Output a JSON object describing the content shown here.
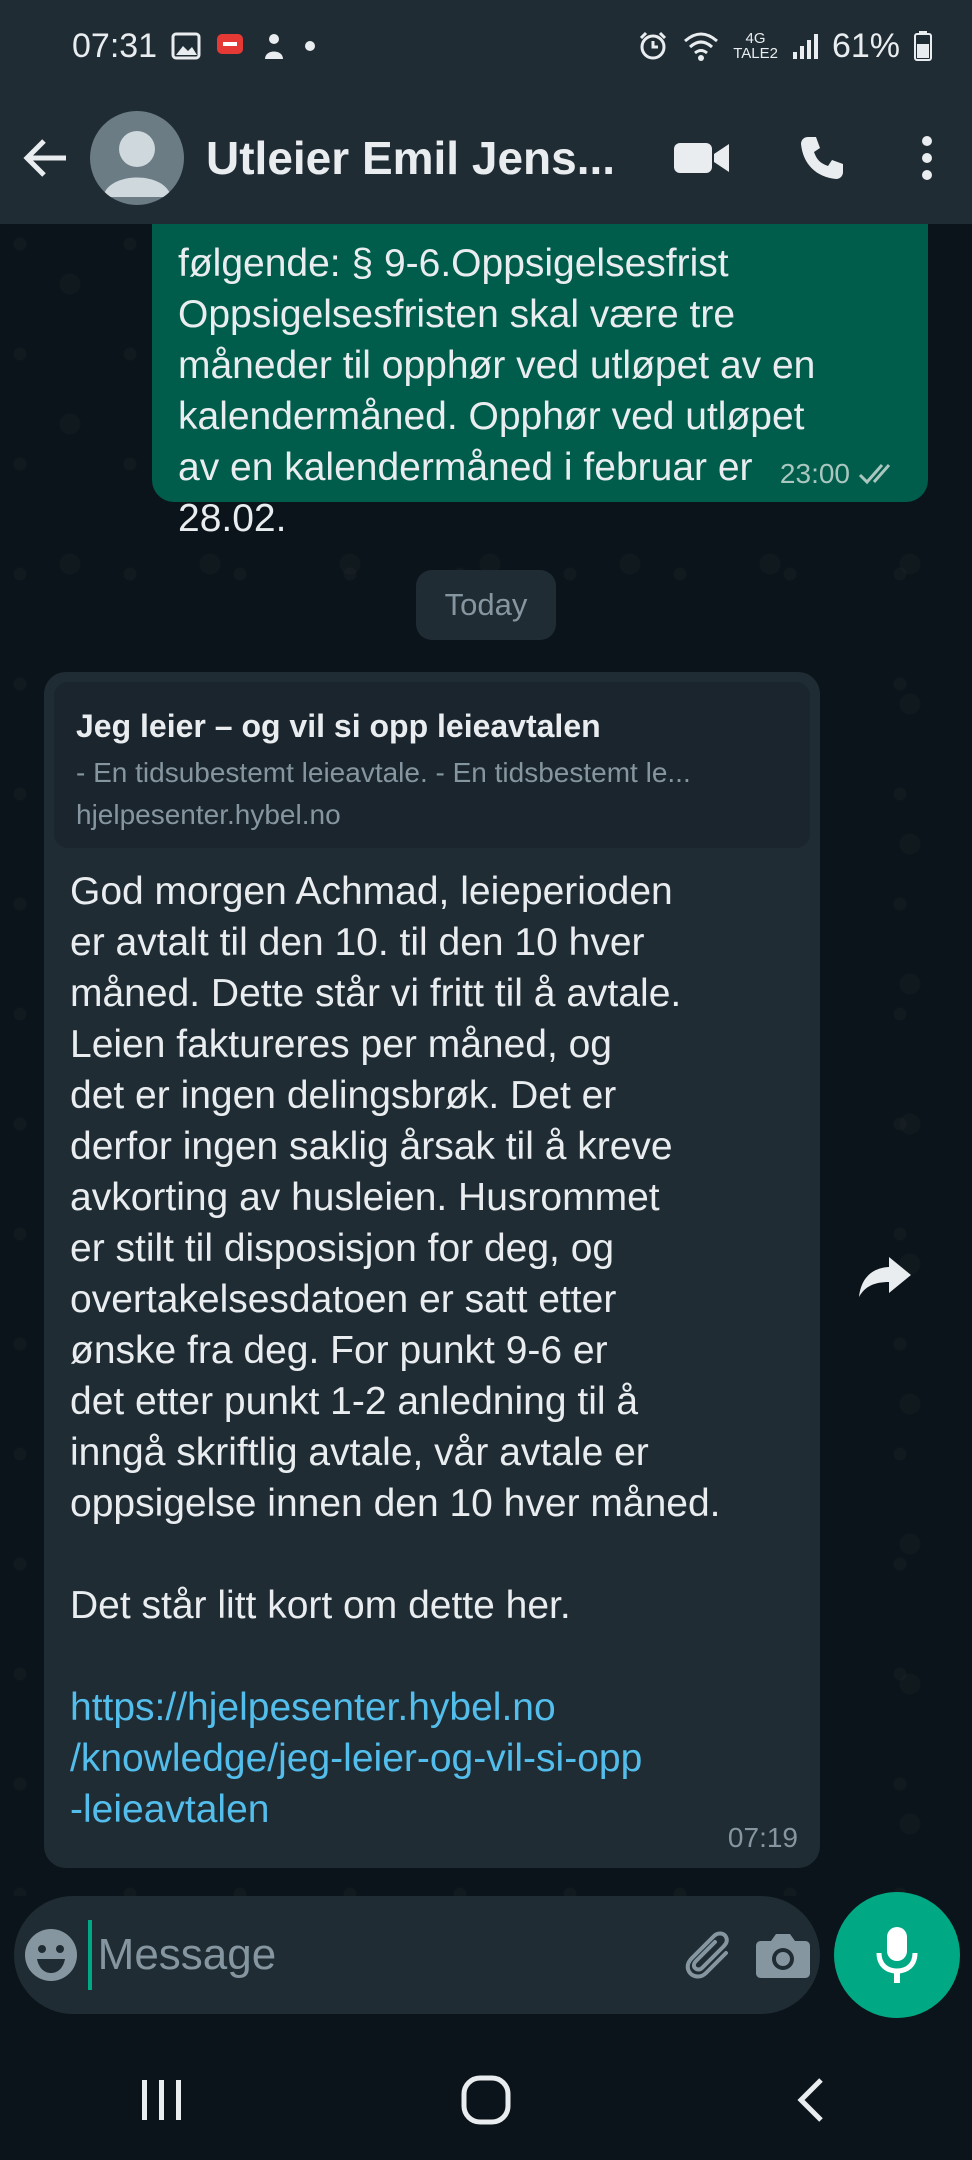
{
  "status_bar": {
    "time": "07:31",
    "network": "4G",
    "operator_tag": "TALE2",
    "battery": "61%"
  },
  "header": {
    "contact_name": "Utleier Emil Jens...",
    "icons": [
      "back-arrow-icon",
      "avatar",
      "video-call-icon",
      "phone-icon",
      "more-vert-icon"
    ]
  },
  "messages": {
    "outgoing": {
      "text": "følgende: § 9-6.Oppsigelsesfrist\nOppsigelsesfristen skal være tre\nmåneder til opphør ved utløpet av en\nkalendermåned. Opphør ved utløpet\nav en kalendermåned i februar er\n28.02.",
      "time": "23:00"
    },
    "date_chip": "Today",
    "incoming": {
      "preview": {
        "title": "Jeg leier – og vil si opp leieavtalen",
        "description": "- En tidsubestemt leieavtale. - En tidsbestemt le...",
        "domain": "hjelpesenter.hybel.no"
      },
      "text": "God morgen Achmad, leieperioden\ner avtalt til den 10. til den 10 hver\nmåned. Dette står vi fritt til å avtale.\nLeien faktureres per måned, og\ndet er ingen delingsbrøk. Det er\nderfor ingen saklig årsak til å kreve\navkorting av husleien. Husrommet\ner stilt til disposisjon for deg, og\novertakelsesdatoen er satt etter\nønske fra deg. For punkt 9-6 er\ndet etter punkt 1-2 anledning til å\ninngå skriftlig avtale, vår avtale er\noppsigelse innen den 10 hver måned.",
      "text2": "Det står litt kort om dette her.",
      "link": "https://hjelpesenter.hybel.no\n/knowledge/jeg-leier-og-vil-si-opp\n-leieavtalen",
      "time": "07:19"
    }
  },
  "composer": {
    "placeholder": "Message"
  },
  "colors": {
    "outgoing_bubble": "#005c4b",
    "incoming_bubble": "#1f2c34",
    "accent": "#00a884",
    "link": "#53bdeb"
  }
}
